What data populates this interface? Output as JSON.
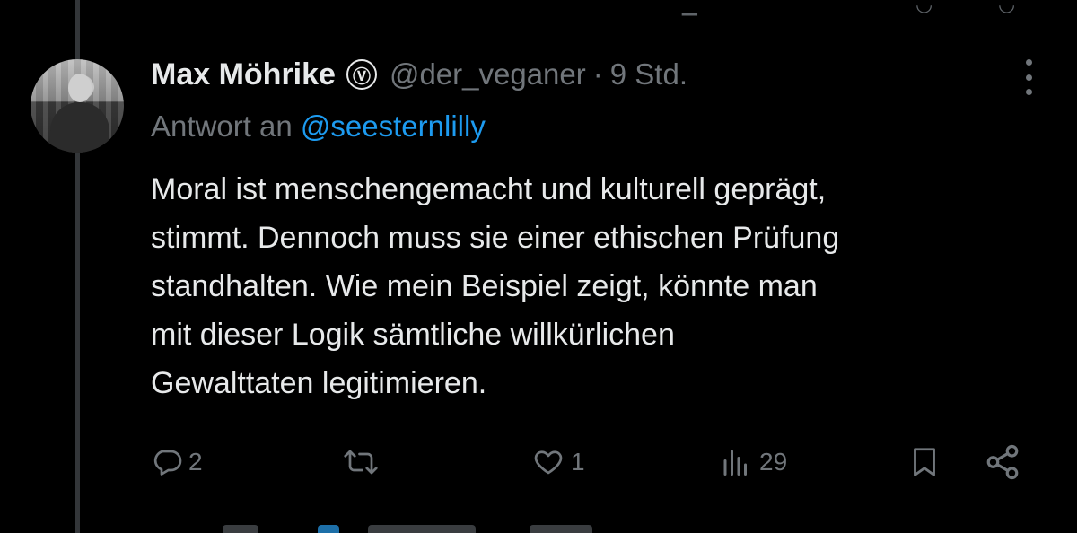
{
  "tweet": {
    "author_name": "Max Möhrike",
    "verified_glyph": "Ⓥ",
    "handle": "@der_veganer",
    "separator": "·",
    "time": "9 Std.",
    "reply_prefix": "Antwort an",
    "reply_mention": "@seesternlilly",
    "text_lines": [
      "Moral ist menschengemacht und kulturell geprägt,",
      "stimmt. Dennoch muss sie einer ethischen Prüfung",
      "standhalten. Wie mein Beispiel zeigt, könnte man",
      "mit dieser Logik sämtliche willkürlichen",
      "Gewalttaten legitimieren."
    ]
  },
  "actions": {
    "reply_count": "2",
    "like_count": "1",
    "view_count": "29"
  },
  "icons": {
    "reply": "reply-icon",
    "retweet": "retweet-icon",
    "like": "heart-icon",
    "views": "views-icon",
    "bookmark": "bookmark-icon",
    "share": "share-icon",
    "more": "more-icon"
  },
  "colors": {
    "background": "#000000",
    "text": "#e7e9ea",
    "muted": "#71767b",
    "link": "#1d9bf0",
    "thread_line": "#333639"
  }
}
